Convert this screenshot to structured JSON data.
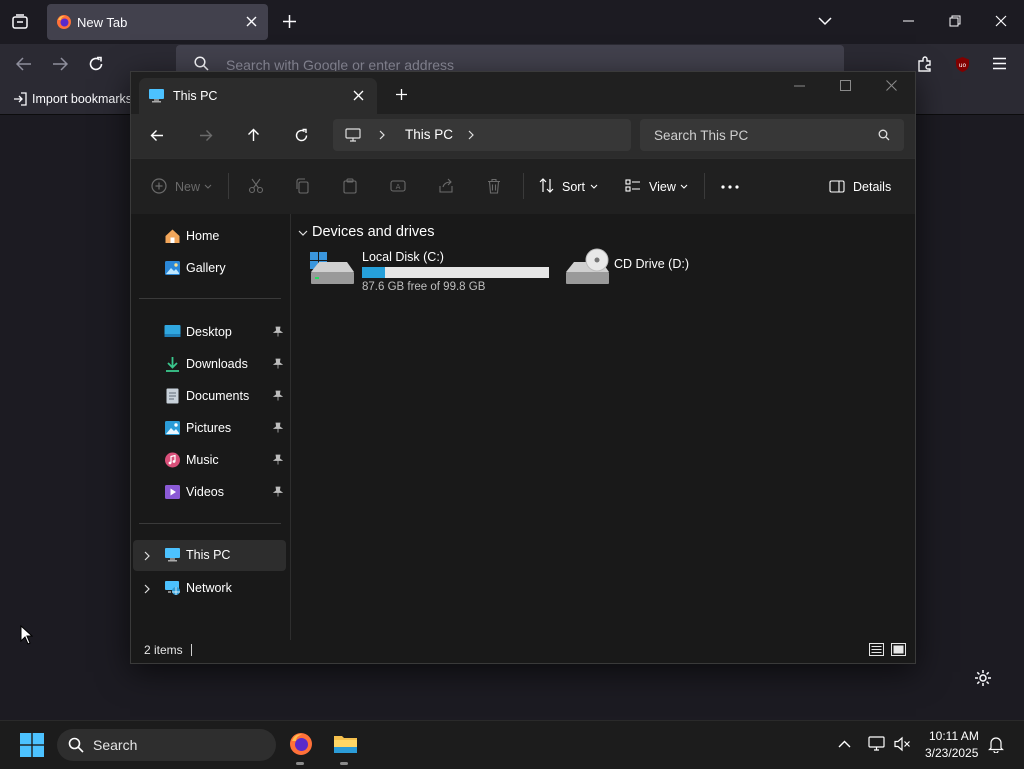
{
  "firefox": {
    "tab_title": "New Tab",
    "url_placeholder": "Search with Google or enter address",
    "bookmarks_import": "Import bookmarks..."
  },
  "explorer": {
    "tab_title": "This PC",
    "breadcrumb": [
      "This PC"
    ],
    "search_placeholder": "Search This PC",
    "toolbar": {
      "new_label": "New",
      "sort_label": "Sort",
      "view_label": "View",
      "details_label": "Details"
    },
    "nav": {
      "quick": [
        "Home",
        "Gallery"
      ],
      "pinned": [
        "Desktop",
        "Downloads",
        "Documents",
        "Pictures",
        "Music",
        "Videos"
      ],
      "roots": [
        "This PC",
        "Network"
      ]
    },
    "content": {
      "group_title": "Devices and drives",
      "drives": [
        {
          "name": "Local Disk (C:)",
          "free_text": "87.6 GB free of 99.8 GB",
          "used_fraction": 0.122
        },
        {
          "name": "CD Drive (D:)"
        }
      ]
    },
    "status": {
      "items": "2 items"
    }
  },
  "taskbar": {
    "search_label": "Search",
    "clock_time": "10:11 AM",
    "clock_date": "3/23/2025"
  },
  "colors": {
    "accent": "#0078d4",
    "drive_bar_fill": "#26a0da",
    "drive_bar_bg": "#e6e6e6",
    "firefox_bg": "#1c1b22",
    "explorer_bg": "#191919"
  }
}
